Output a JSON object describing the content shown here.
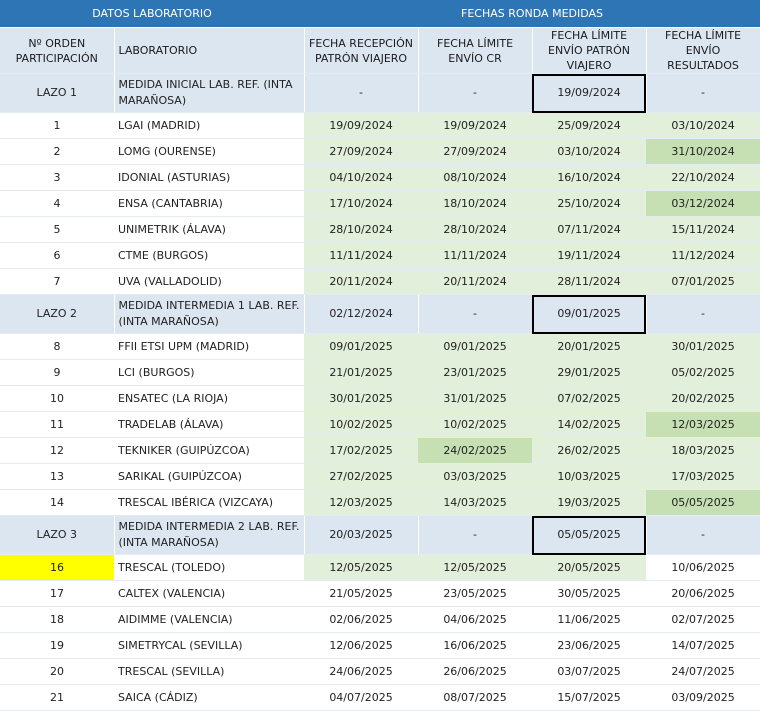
{
  "header": {
    "group_lab": "DATOS LABORATORIO",
    "group_dates": "FECHAS RONDA MEDIDAS",
    "col_orden": "Nº ORDEN PARTICIPACIÓN",
    "col_lab": "LABORATORIO",
    "col_recepcion": "FECHA RECEPCIÓN PATRÓN VIAJERO",
    "col_cr": "FECHA LÍMITE ENVÍO CR",
    "col_envio_patron": "FECHA LÍMITE ENVÍO PATRÓN VIAJERO",
    "col_resultados": "FECHA LÍMITE ENVÍO RESULTADOS"
  },
  "rows": [
    {
      "id": "LAZO 1",
      "lab": "MEDIDA INICIAL LAB. REF. (INTA MARAÑOSA)",
      "recep": "-",
      "cr": "-",
      "envio": "19/09/2024",
      "res": "-",
      "lazo": true
    },
    {
      "id": "1",
      "lab": "LGAI (MADRID)",
      "recep": "19/09/2024",
      "cr": "19/09/2024",
      "envio": "25/09/2024",
      "res": "03/10/2024"
    },
    {
      "id": "2",
      "lab": "LOMG (OURENSE)",
      "recep": "27/09/2024",
      "cr": "27/09/2024",
      "envio": "03/10/2024",
      "res": "31/10/2024"
    },
    {
      "id": "3",
      "lab": "IDONIAL (ASTURIAS)",
      "recep": "04/10/2024",
      "cr": "08/10/2024",
      "envio": "16/10/2024",
      "res": "22/10/2024"
    },
    {
      "id": "4",
      "lab": "ENSA (CANTABRIA)",
      "recep": "17/10/2024",
      "cr": "18/10/2024",
      "envio": "25/10/2024",
      "res": "03/12/2024"
    },
    {
      "id": "5",
      "lab": "UNIMETRIK (ÁLAVA)",
      "recep": "28/10/2024",
      "cr": "28/10/2024",
      "envio": "07/11/2024",
      "res": "15/11/2024"
    },
    {
      "id": "6",
      "lab": "CTME (BURGOS)",
      "recep": "11/11/2024",
      "cr": "11/11/2024",
      "envio": "19/11/2024",
      "res": "11/12/2024"
    },
    {
      "id": "7",
      "lab": "UVA (VALLADOLID)",
      "recep": "20/11/2024",
      "cr": "20/11/2024",
      "envio": "28/11/2024",
      "res": "07/01/2025"
    },
    {
      "id": "LAZO 2",
      "lab": "MEDIDA INTERMEDIA 1 LAB. REF. (INTA MARAÑOSA)",
      "recep": "02/12/2024",
      "cr": "-",
      "envio": "09/01/2025",
      "res": "-",
      "lazo": true
    },
    {
      "id": "8",
      "lab": "FFII ETSI UPM (MADRID)",
      "recep": "09/01/2025",
      "cr": "09/01/2025",
      "envio": "20/01/2025",
      "res": "30/01/2025"
    },
    {
      "id": "9",
      "lab": "LCI (BURGOS)",
      "recep": "21/01/2025",
      "cr": "23/01/2025",
      "envio": "29/01/2025",
      "res": "05/02/2025"
    },
    {
      "id": "10",
      "lab": "ENSATEC (LA RIOJA)",
      "recep": "30/01/2025",
      "cr": "31/01/2025",
      "envio": "07/02/2025",
      "res": "20/02/2025"
    },
    {
      "id": "11",
      "lab": "TRADELAB (ÁLAVA)",
      "recep": "10/02/2025",
      "cr": "10/02/2025",
      "envio": "14/02/2025",
      "res": "12/03/2025"
    },
    {
      "id": "12",
      "lab": "TEKNIKER (GUIPÚZCOA)",
      "recep": "17/02/2025",
      "cr": "24/02/2025",
      "envio": "26/02/2025",
      "res": "18/03/2025"
    },
    {
      "id": "13",
      "lab": "SARIKAL (GUIPÚZCOA)",
      "recep": "27/02/2025",
      "cr": "03/03/2025",
      "envio": "10/03/2025",
      "res": "17/03/2025"
    },
    {
      "id": "14",
      "lab": "TRESCAL IBÉRICA (VIZCAYA)",
      "recep": "12/03/2025",
      "cr": "14/03/2025",
      "envio": "19/03/2025",
      "res": "05/05/2025"
    },
    {
      "id": "LAZO 3",
      "lab": "MEDIDA INTERMEDIA 2 LAB. REF. (INTA MARAÑOSA)",
      "recep": "20/03/2025",
      "cr": "-",
      "envio": "05/05/2025",
      "res": "-",
      "lazo": true
    },
    {
      "id": "16",
      "lab": "TRESCAL (TOLEDO)",
      "recep": "12/05/2025",
      "cr": "12/05/2025",
      "envio": "20/05/2025",
      "res": "10/06/2025"
    },
    {
      "id": "17",
      "lab": "CALTEX (VALENCIA)",
      "recep": "21/05/2025",
      "cr": "23/05/2025",
      "envio": "30/05/2025",
      "res": "20/06/2025"
    },
    {
      "id": "18",
      "lab": "AIDIMME (VALENCIA)",
      "recep": "02/06/2025",
      "cr": "04/06/2025",
      "envio": "11/06/2025",
      "res": "02/07/2025"
    },
    {
      "id": "19",
      "lab": "SIMETRYCAL (SEVILLA)",
      "recep": "12/06/2025",
      "cr": "16/06/2025",
      "envio": "23/06/2025",
      "res": "14/07/2025"
    },
    {
      "id": "20",
      "lab": "TRESCAL (SEVILLA)",
      "recep": "24/06/2025",
      "cr": "26/06/2025",
      "envio": "03/07/2025",
      "res": "24/07/2025"
    },
    {
      "id": "21",
      "lab": "SAICA (CÁDIZ)",
      "recep": "04/07/2025",
      "cr": "08/07/2025",
      "envio": "15/07/2025",
      "res": "03/09/2025"
    }
  ],
  "colors": {
    "header": "#2e75b6",
    "lazo": "#dce6f1",
    "green_light": "#e2efda",
    "green_dark": "#c6e0b4",
    "highlight": "#ffff00"
  }
}
